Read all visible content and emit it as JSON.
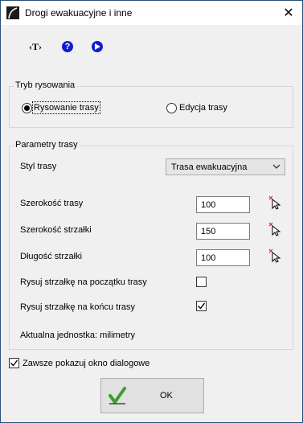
{
  "window": {
    "title": "Drogi ewakuacyjne i inne",
    "close_label": "✕"
  },
  "toolbar": {
    "text_tool_label": "‹T›",
    "help_label": "?"
  },
  "drawing_mode": {
    "legend": "Tryb rysowania",
    "options": [
      {
        "label": "Rysowanie trasy",
        "selected": true
      },
      {
        "label": "Edycja trasy",
        "selected": false
      }
    ]
  },
  "route_params": {
    "legend": "Parametry trasy",
    "style": {
      "label": "Styl trasy",
      "value": "Trasa ewakuacyjna"
    },
    "route_width": {
      "label": "Szerokość trasy",
      "value": "100"
    },
    "arrow_width": {
      "label": "Szerokość strzałki",
      "value": "150"
    },
    "arrow_length": {
      "label": "Długość strzałki",
      "value": "100"
    },
    "arrow_start": {
      "label": "Rysuj strzałkę na początku trasy",
      "checked": false
    },
    "arrow_end": {
      "label": "Rysuj strzałkę na końcu trasy",
      "checked": true
    },
    "unit_text": "Aktualna jednostka: milimetry"
  },
  "always_show": {
    "label": "Zawsze pokazuj okno dialogowe",
    "checked": true
  },
  "ok_button": {
    "label": "OK"
  },
  "colors": {
    "accent_blue": "#0f1fc8",
    "check_green": "#3aa12a"
  }
}
